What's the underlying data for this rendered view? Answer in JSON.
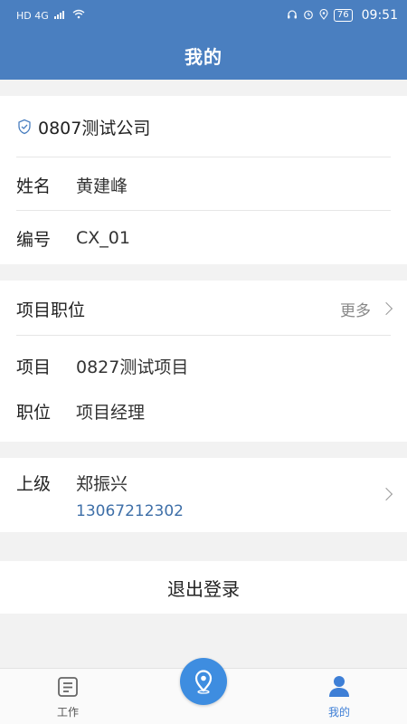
{
  "status_bar": {
    "network": "HD 4G",
    "battery": "76",
    "time": "09:51"
  },
  "header": {
    "title": "我的"
  },
  "company": {
    "name": "0807测试公司",
    "icon": "shield-check-icon"
  },
  "profile": {
    "name_label": "姓名",
    "name_value": "黄建峰",
    "id_label": "编号",
    "id_value": "CX_01"
  },
  "project_position": {
    "title": "项目职位",
    "more_label": "更多",
    "project_label": "项目",
    "project_value": "0827测试项目",
    "position_label": "职位",
    "position_value": "项目经理"
  },
  "superior": {
    "label": "上级",
    "name": "郑振兴",
    "phone": "13067212302"
  },
  "logout_label": "退出登录",
  "tabbar": {
    "work_label": "工作",
    "mine_label": "我的",
    "accent_color": "#3e7fd6"
  },
  "theme": {
    "header_color": "#4a7fc0"
  }
}
